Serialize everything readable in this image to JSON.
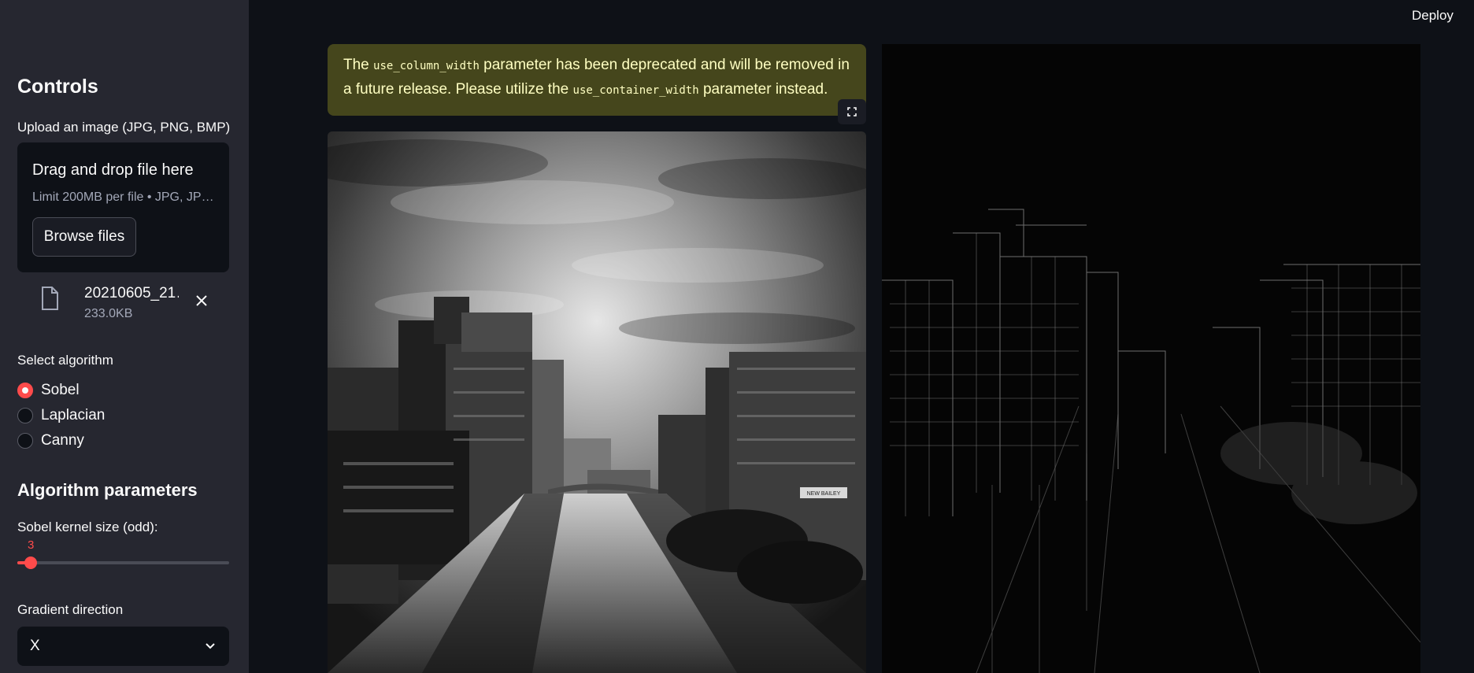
{
  "header": {
    "deploy_label": "Deploy"
  },
  "sidebar": {
    "title": "Controls",
    "upload_label": "Upload an image (JPG, PNG, BMP)",
    "uploader": {
      "drag_text": "Drag and drop file here",
      "limit_text": "Limit 200MB per file • JPG, JP…",
      "browse_label": "Browse files"
    },
    "file": {
      "name": "20210605_21…",
      "size": "233.0KB"
    },
    "algorithm_label": "Select algorithm",
    "algorithms": [
      {
        "label": "Sobel",
        "checked": true
      },
      {
        "label": "Laplacian",
        "checked": false
      },
      {
        "label": "Canny",
        "checked": false
      }
    ],
    "params_title": "Algorithm parameters",
    "kernel_label": "Sobel kernel size (odd):",
    "kernel_value": "3",
    "direction_label": "Gradient direction",
    "direction_value": "X"
  },
  "main": {
    "warning": {
      "part1": "The ",
      "code1": "use_column_width",
      "part2": " parameter has been deprecated and will be removed in a future release. Please utilize the ",
      "code2": "use_container_width",
      "part3": " parameter instead."
    },
    "sign_text": "NEW BAILEY"
  },
  "colors": {
    "accent": "#ff4b4b",
    "warning_bg": "#45461c",
    "warning_text": "#ffffc2"
  }
}
